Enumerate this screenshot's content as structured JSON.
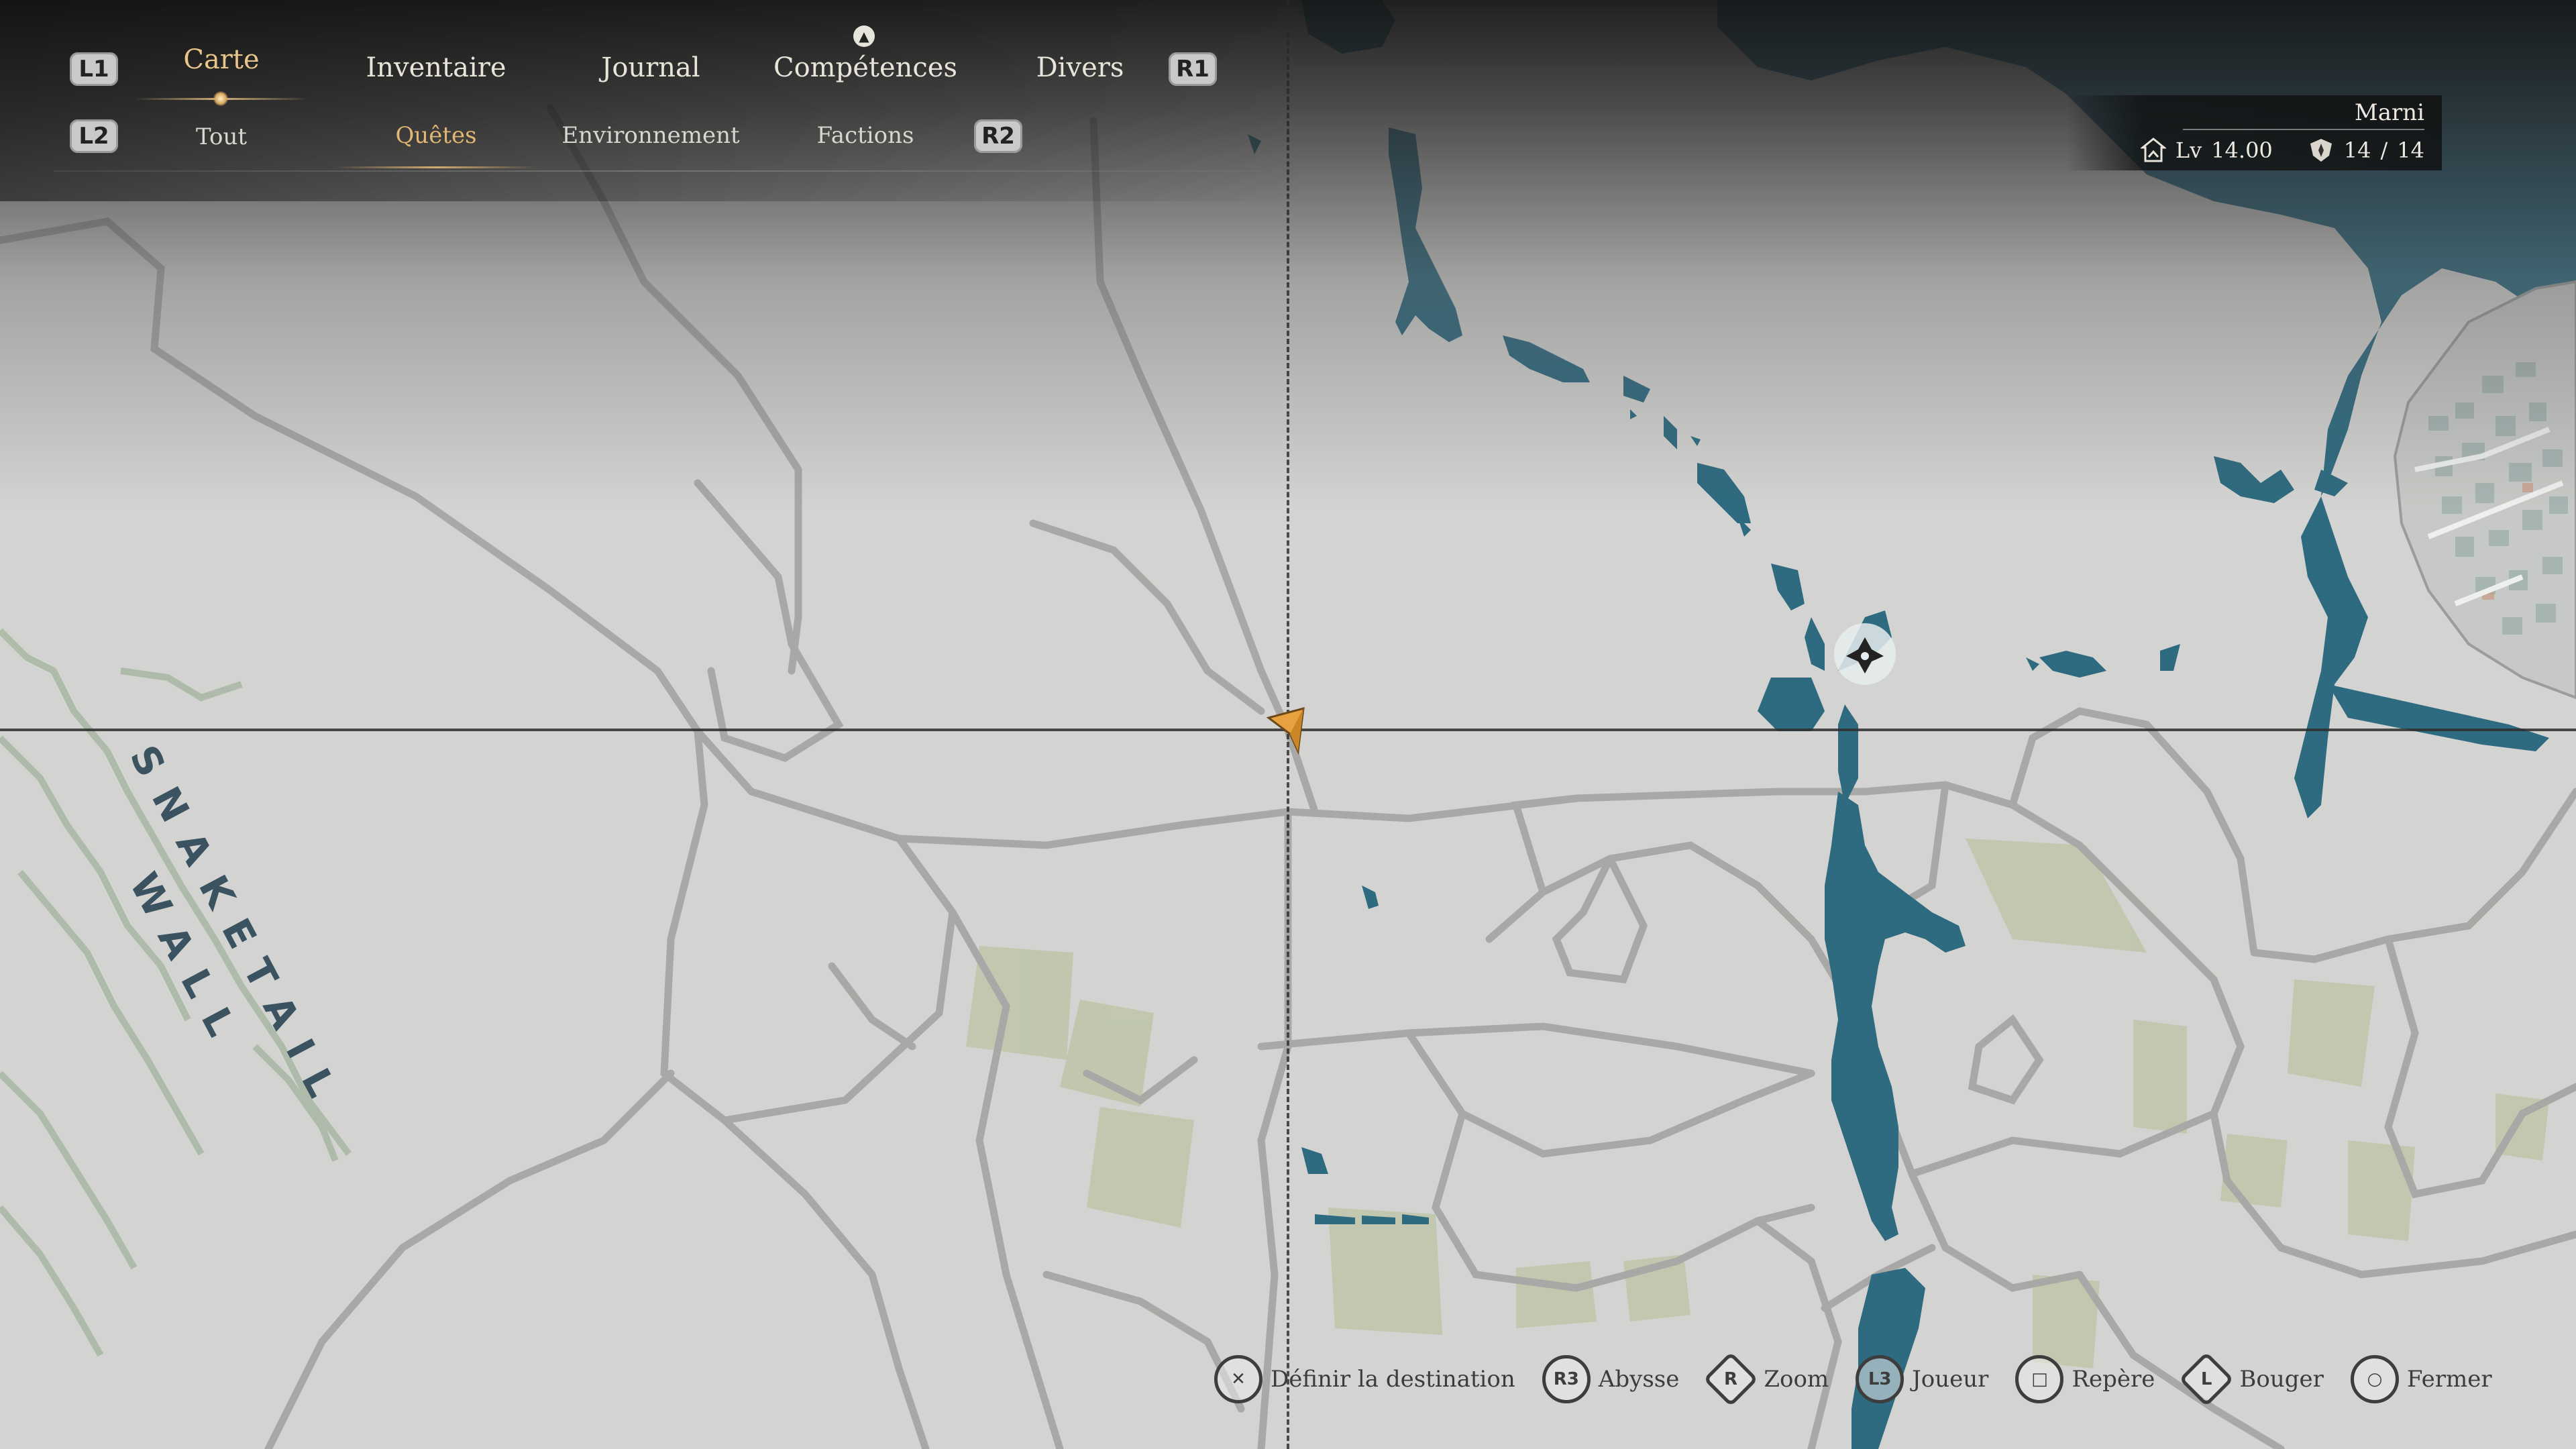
{
  "nav": {
    "tabs": [
      {
        "label": "Carte",
        "active": true
      },
      {
        "label": "Inventaire",
        "active": false
      },
      {
        "label": "Journal",
        "active": false
      },
      {
        "label": "Compétences",
        "active": false
      },
      {
        "label": "Divers",
        "active": false
      }
    ],
    "subtabs": [
      {
        "label": "Tout",
        "active": false
      },
      {
        "label": "Quêtes",
        "active": true
      },
      {
        "label": "Environnement",
        "active": false
      },
      {
        "label": "Factions",
        "active": false
      }
    ],
    "buttons": {
      "l1": "L1",
      "r1": "R1",
      "l2": "L2",
      "r2": "R2"
    }
  },
  "player": {
    "name": "Marni",
    "level_label": "Lv",
    "level": "14.00",
    "health_current": "14",
    "health_separator": "/",
    "health_max": "14"
  },
  "map": {
    "region_label_line1": "SNAKETAIL",
    "region_label_line2": "WALL"
  },
  "prompts": [
    {
      "button": "✕",
      "label": "Définir la destination"
    },
    {
      "button": "R3",
      "label": "Abysse"
    },
    {
      "button": "R",
      "label": "Zoom"
    },
    {
      "button": "L3",
      "label": "Joueur"
    },
    {
      "button": "□",
      "label": "Repère"
    },
    {
      "button": "L",
      "label": "Bouger"
    },
    {
      "button": "○",
      "label": "Fermer"
    }
  ],
  "colors": {
    "land": "#d3d3d1",
    "water": "#2e6a80",
    "road": "#a9a9a7",
    "field": "#bcc4a8",
    "accent": "#e2b673",
    "text_light": "#e8e4da"
  }
}
